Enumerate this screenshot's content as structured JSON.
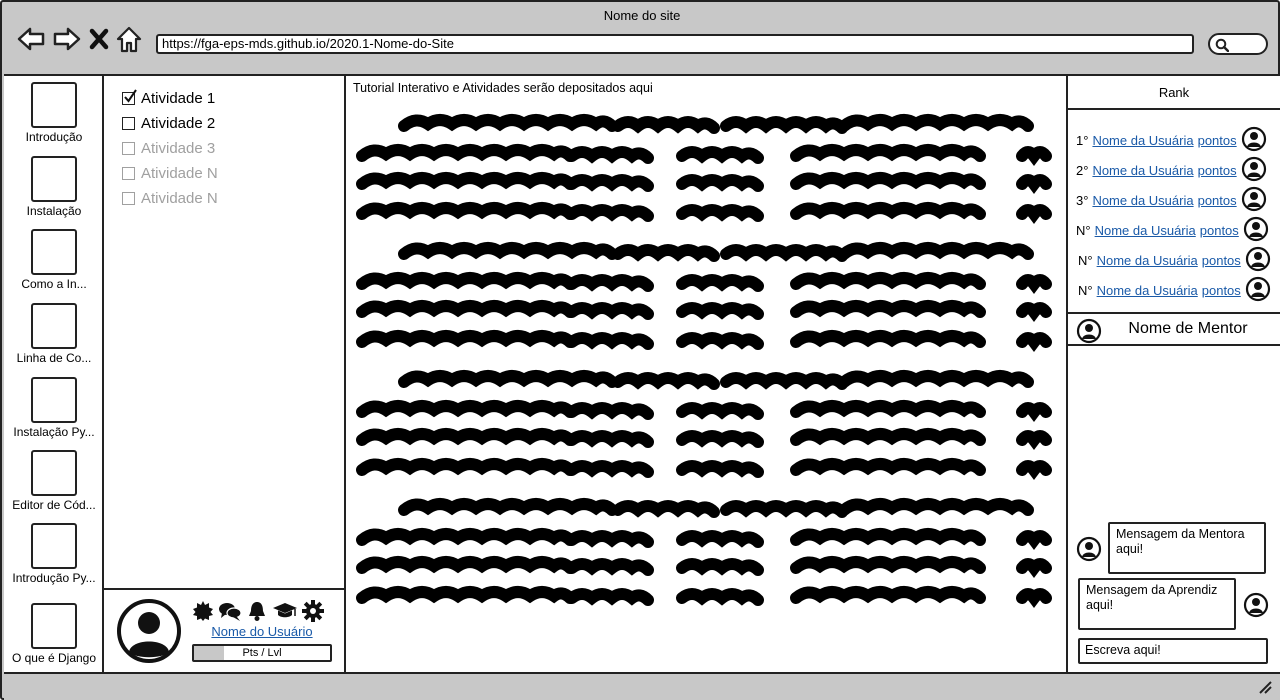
{
  "browser": {
    "site_name": "Nome do site",
    "url": "https://fga-eps-mds.github.io/2020.1-Nome-do-Site"
  },
  "left_nav": {
    "items": [
      {
        "label": "Introdução"
      },
      {
        "label": "Instalação"
      },
      {
        "label": "Como a In..."
      },
      {
        "label": "Linha de Co..."
      },
      {
        "label": "Instalação Py..."
      },
      {
        "label": "Editor de Cód..."
      },
      {
        "label": "Introdução Py..."
      },
      {
        "label": "O que é Django"
      }
    ]
  },
  "activities": {
    "items": [
      {
        "label": "Atividade 1",
        "checked": true,
        "enabled": true
      },
      {
        "label": "Atividade 2",
        "checked": false,
        "enabled": true
      },
      {
        "label": "Atividade 3",
        "checked": false,
        "enabled": false
      },
      {
        "label": "Atividade N",
        "checked": false,
        "enabled": false
      },
      {
        "label": "Atividade N",
        "checked": false,
        "enabled": false
      }
    ]
  },
  "user_panel": {
    "user_name": "Nome do Usuário",
    "pts_label": "Pts / Lvl",
    "progress": 0.22,
    "icons": [
      "badge-icon",
      "chat-icon",
      "bell-icon",
      "graduation-cap-icon",
      "gear-icon"
    ]
  },
  "main": {
    "title": "Tutorial Interativo e Atividades serão depositados aqui"
  },
  "rank": {
    "title": "Rank",
    "rows": [
      {
        "position": "1°",
        "name": "Nome da Usuária",
        "points": "pontos"
      },
      {
        "position": "2°",
        "name": "Nome da Usuária",
        "points": "pontos"
      },
      {
        "position": "3°",
        "name": "Nome da Usuária",
        "points": "pontos"
      },
      {
        "position": "N°",
        "name": "Nome da Usuária",
        "points": "pontos"
      },
      {
        "position": "N°",
        "name": "Nome da Usuária",
        "points": "pontos"
      },
      {
        "position": "N°",
        "name": "Nome da Usuária",
        "points": "pontos"
      }
    ]
  },
  "mentor": {
    "name": "Nome de Mentor",
    "mentor_message": "Mensagem da Mentora aqui!",
    "learner_message": "Mensagem da Aprendiz aqui!",
    "input_placeholder": "Escreva aqui!"
  }
}
